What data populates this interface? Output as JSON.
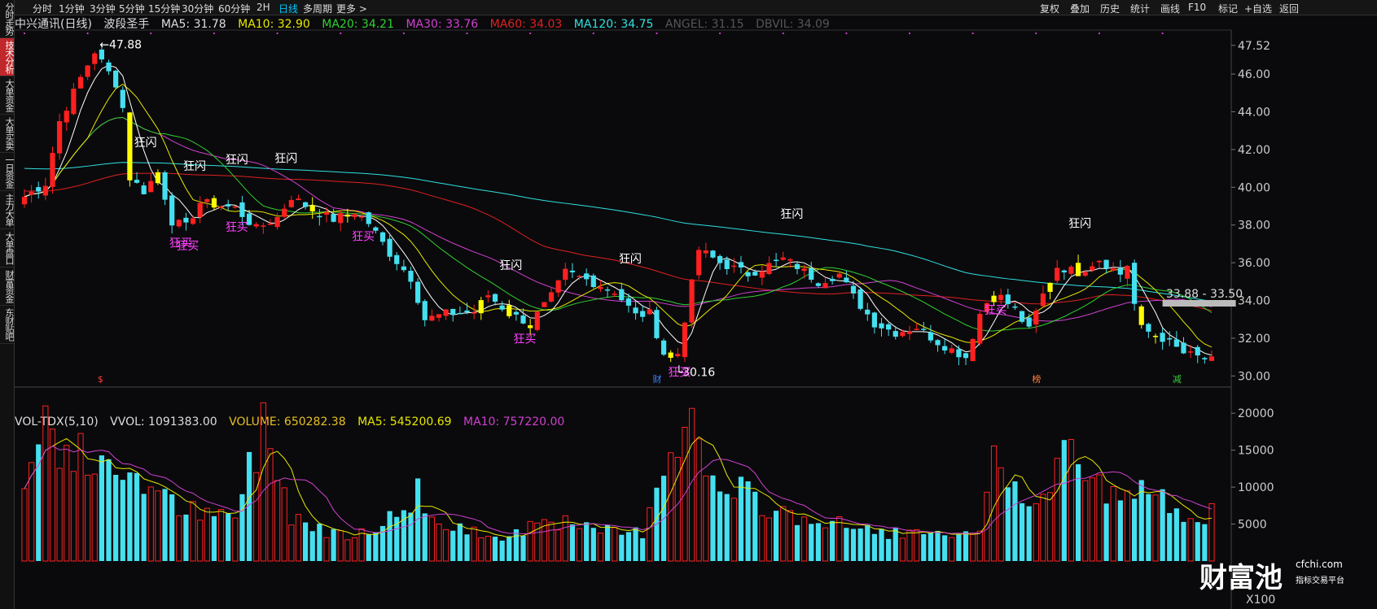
{
  "sidebar": {
    "items": [
      {
        "label": "分时走势",
        "active": false
      },
      {
        "label": "技术分析",
        "active": true
      },
      {
        "label": "大单资金",
        "active": false
      },
      {
        "label": "大单买卖",
        "active": false
      },
      {
        "label": "一日资金",
        "active": false
      },
      {
        "label": "主力大单",
        "active": false
      },
      {
        "label": "大单盘口",
        "active": false
      },
      {
        "label": "财富资金",
        "active": false
      },
      {
        "label": "东财贴吧",
        "active": false
      }
    ]
  },
  "toolbar": {
    "periods": [
      "分时",
      "1分钟",
      "3分钟",
      "5分钟",
      "15分钟",
      "30分钟",
      "60分钟",
      "2H",
      "日线",
      "多周期",
      "更多 >"
    ],
    "active_period": "日线",
    "right_menu": [
      "复权",
      "叠加",
      "历史",
      "统计",
      "画线",
      "F10",
      "标记",
      "+自选",
      "返回"
    ]
  },
  "main_legend": {
    "stock": "中兴通讯(日线)",
    "indicator": "波段圣手",
    "ma5": "MA5: 31.78",
    "ma10": "MA10: 32.90",
    "ma20": "MA20: 34.21",
    "ma30": "MA30: 33.76",
    "ma60": "MA60: 34.03",
    "ma120": "MA120: 34.75",
    "angel": "ANGEL: 31.15",
    "dbvil": "DBVIL: 34.09"
  },
  "vol_legend": {
    "name": "VOL-TDX(5,10)",
    "vvol": "VVOL: 1091383.00",
    "volume": "VOLUME: 650282.38",
    "ma5": "MA5: 545200.69",
    "ma10": "MA10: 757220.00"
  },
  "colors": {
    "up": "#ff2020",
    "down": "#45e0f0",
    "ma5": "#ffffff",
    "ma10": "#e8e800",
    "ma20": "#30d030",
    "ma30": "#d040d0",
    "ma60": "#e02020",
    "ma120": "#30e0e0",
    "signal": "#ffff00",
    "flash_text": "#ffffff",
    "buy_text": "#ff40ff"
  },
  "price_axis": {
    "ticks": [
      "47.52",
      "46.00",
      "44.00",
      "42.00",
      "40.00",
      "38.00",
      "36.00",
      "34.00",
      "32.00",
      "30.00"
    ],
    "tick_values": [
      47.52,
      46,
      44,
      42,
      40,
      38,
      36,
      34,
      32,
      30
    ],
    "range": [
      29.5,
      48.2
    ]
  },
  "volume_axis": {
    "ticks": [
      "20000",
      "15000",
      "10000",
      "5000"
    ],
    "tick_values": [
      20000,
      15000,
      10000,
      5000
    ],
    "unit": "X100",
    "range": [
      0,
      22000
    ]
  },
  "annotations": {
    "high": "47.88",
    "low": "30.16",
    "flash": "狂闪",
    "buy": "狂买",
    "range_box": "33.88 - 33.50",
    "events": [
      {
        "text": "$",
        "index": 11,
        "color": "#ff4040"
      },
      {
        "text": "财",
        "index": 90,
        "color": "#4080ff"
      },
      {
        "text": "榜",
        "index": 144,
        "color": "#ff8040"
      },
      {
        "text": "减",
        "index": 164,
        "color": "#30d030"
      }
    ]
  },
  "chart_data": {
    "type": "candlestick",
    "title": "中兴通讯(日线)",
    "n": 170,
    "anchors": [
      [
        0,
        39.5
      ],
      [
        3,
        40.2
      ],
      [
        5,
        43.5
      ],
      [
        8,
        45.8
      ],
      [
        10,
        47.2
      ],
      [
        13,
        45.5
      ],
      [
        14,
        44.2
      ],
      [
        15,
        40.5
      ],
      [
        17,
        39.8
      ],
      [
        19,
        40.8
      ],
      [
        21,
        38.2
      ],
      [
        23,
        37.9
      ],
      [
        25,
        39.2
      ],
      [
        30,
        38.9
      ],
      [
        33,
        37.8
      ],
      [
        36,
        38.4
      ],
      [
        38,
        39.5
      ],
      [
        41,
        38.8
      ],
      [
        44,
        38.3
      ],
      [
        47,
        38.7
      ],
      [
        49,
        38.1
      ],
      [
        52,
        36.5
      ],
      [
        55,
        35.2
      ],
      [
        57,
        33.0
      ],
      [
        60,
        33.3
      ],
      [
        64,
        33.4
      ],
      [
        66,
        34.3
      ],
      [
        69,
        33.3
      ],
      [
        72,
        32.8
      ],
      [
        75,
        34.2
      ],
      [
        77,
        35.5
      ],
      [
        80,
        35.1
      ],
      [
        84,
        34.5
      ],
      [
        87,
        33.2
      ],
      [
        89,
        33.3
      ],
      [
        91,
        31.2
      ],
      [
        93,
        31.2
      ],
      [
        96,
        36.7
      ],
      [
        99,
        36.0
      ],
      [
        103,
        35.4
      ],
      [
        108,
        36.2
      ],
      [
        110,
        35.8
      ],
      [
        113,
        35.0
      ],
      [
        116,
        35.4
      ],
      [
        118,
        34.2
      ],
      [
        121,
        32.8
      ],
      [
        124,
        32.3
      ],
      [
        127,
        32.6
      ],
      [
        130,
        31.8
      ],
      [
        134,
        31.0
      ],
      [
        136,
        33.3
      ],
      [
        138,
        34.5
      ],
      [
        141,
        33.5
      ],
      [
        143,
        32.4
      ],
      [
        145,
        34.3
      ],
      [
        147,
        35.8
      ],
      [
        150,
        35.5
      ],
      [
        153,
        36.2
      ],
      [
        156,
        35.4
      ],
      [
        157,
        35.9
      ],
      [
        158,
        33.8
      ],
      [
        159,
        32.5
      ],
      [
        162,
        32.0
      ],
      [
        165,
        31.2
      ],
      [
        169,
        30.8
      ]
    ],
    "volume_anchors": [
      [
        0,
        9800
      ],
      [
        3,
        19500
      ],
      [
        6,
        14500
      ],
      [
        9,
        13800
      ],
      [
        12,
        11500
      ],
      [
        16,
        12500
      ],
      [
        19,
        8500
      ],
      [
        22,
        7500
      ],
      [
        26,
        5800
      ],
      [
        30,
        6200
      ],
      [
        34,
        18500
      ],
      [
        38,
        6500
      ],
      [
        42,
        4300
      ],
      [
        46,
        3800
      ],
      [
        50,
        4800
      ],
      [
        54,
        6500
      ],
      [
        56,
        9800
      ],
      [
        59,
        4500
      ],
      [
        63,
        4000
      ],
      [
        67,
        3500
      ],
      [
        71,
        4200
      ],
      [
        74,
        6500
      ],
      [
        78,
        4500
      ],
      [
        82,
        4000
      ],
      [
        86,
        3800
      ],
      [
        88,
        4000
      ],
      [
        91,
        14000
      ],
      [
        94,
        19800
      ],
      [
        96,
        15500
      ],
      [
        99,
        8500
      ],
      [
        102,
        9200
      ],
      [
        106,
        7200
      ],
      [
        110,
        6000
      ],
      [
        114,
        5200
      ],
      [
        118,
        4500
      ],
      [
        122,
        4000
      ],
      [
        127,
        3600
      ],
      [
        132,
        3200
      ],
      [
        136,
        3300
      ],
      [
        138,
        17500
      ],
      [
        140,
        11500
      ],
      [
        143,
        7500
      ],
      [
        146,
        8500
      ],
      [
        148,
        19000
      ],
      [
        151,
        11000
      ],
      [
        154,
        9500
      ],
      [
        157,
        8000
      ],
      [
        160,
        9800
      ],
      [
        163,
        7500
      ],
      [
        166,
        6800
      ],
      [
        169,
        6500
      ]
    ],
    "ma_lines": [
      {
        "name": "MA5",
        "value": 31.78
      },
      {
        "name": "MA10",
        "value": 32.9
      },
      {
        "name": "MA20",
        "value": 34.21
      },
      {
        "name": "MA30",
        "value": 33.76
      },
      {
        "name": "MA60",
        "value": 34.03
      },
      {
        "name": "MA120",
        "value": 34.75
      }
    ],
    "flash_labels": [
      17,
      24,
      30,
      37,
      69,
      86,
      109,
      150
    ],
    "buy_labels": [
      22,
      23,
      30,
      48,
      71,
      93,
      138
    ],
    "signal_bars": [
      15,
      19,
      27,
      41,
      46,
      65,
      69,
      72,
      92,
      138,
      146,
      150,
      159,
      161
    ]
  }
}
